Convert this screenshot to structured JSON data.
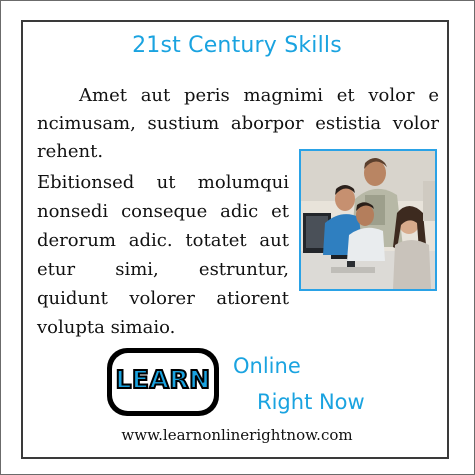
{
  "card": {
    "title": "21st Century Skills",
    "paragraph_top": "Amet aut peris magnimi  et volor e ncimusam, sustium aborpor estistia volor rehent.",
    "paragraph_side": "Ebitionsed ut molumqui nonsedi conseque  adic et derorum adic.  totatet aut etur simi, estruntur, quidunt volorer atiorent volupta simaio.",
    "photo_icon": "students-at-computer-photo"
  },
  "footer": {
    "logo_text": "LEARN",
    "tagline_line1": "Online",
    "tagline_line2": "Right Now",
    "url": "www.learnonlinerightnow.com"
  },
  "colors": {
    "accent": "#1aa3e0",
    "photo_border": "#2aa2e6",
    "text": "#111111",
    "panel_border": "#3a3a3a"
  }
}
